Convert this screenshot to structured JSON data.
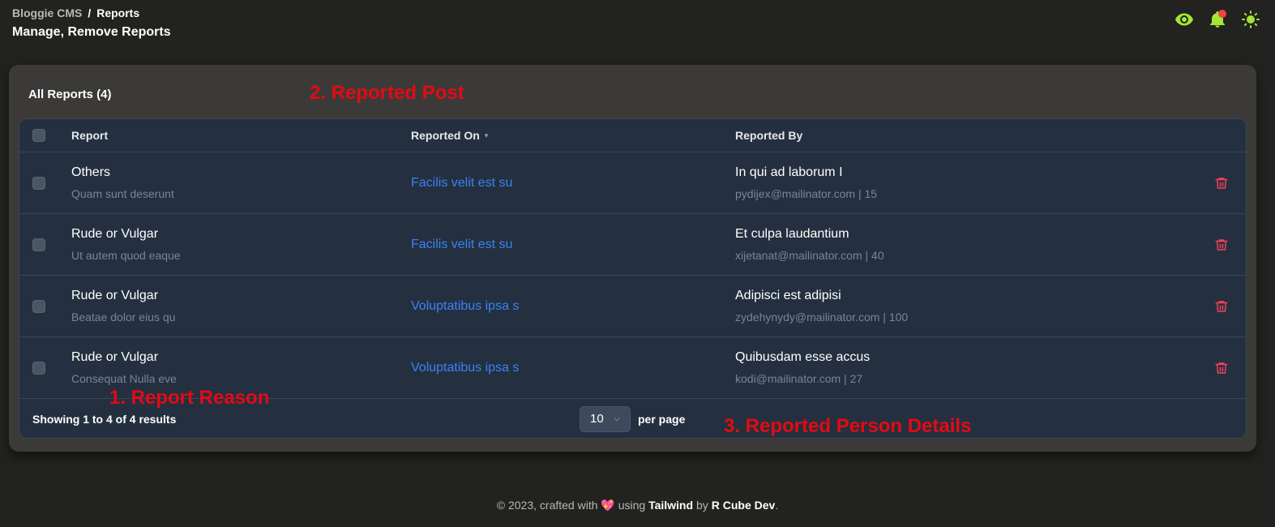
{
  "breadcrumb": {
    "root": "Bloggie CMS",
    "separator": "/",
    "current": "Reports"
  },
  "page_title": "Manage, Remove Reports",
  "header_icons": [
    "eye-icon",
    "bell-icon",
    "sun-icon"
  ],
  "colors": {
    "accent_icons": "#a3e635",
    "link": "#3b82f6",
    "delete": "#f43f5e",
    "annotation": "#e50914"
  },
  "card": {
    "title": "All Reports (4)"
  },
  "table": {
    "headers": {
      "report": "Report",
      "reported_on": "Reported On",
      "reported_by": "Reported By"
    },
    "rows": [
      {
        "reason": "Others",
        "detail": "Quam sunt deserunt",
        "post": "Facilis velit est su",
        "name": "In qui ad laborum I",
        "email": "pydijex@mailinator.com",
        "count": "15"
      },
      {
        "reason": "Rude or Vulgar",
        "detail": "Ut autem quod eaque",
        "post": "Facilis velit est su",
        "name": "Et culpa laudantium",
        "email": "xijetanat@mailinator.com",
        "count": "40"
      },
      {
        "reason": "Rude or Vulgar",
        "detail": "Beatae dolor eius qu",
        "post": "Voluptatibus ipsa s",
        "name": "Adipisci est adipisi",
        "email": "zydehynydy@mailinator.com",
        "count": "100"
      },
      {
        "reason": "Rude or Vulgar",
        "detail": "Consequat Nulla eve",
        "post": "Voluptatibus ipsa s",
        "name": "Quibusdam esse accus",
        "email": "kodi@mailinator.com",
        "count": "27"
      }
    ],
    "pipe": "|"
  },
  "pagination": {
    "showing": "Showing 1 to 4 of 4 results",
    "per_page_value": "10",
    "per_page_label": "per page"
  },
  "annotations": {
    "a1": "1. Report Reason",
    "a2": "2. Reported Post",
    "a3": "3. Reported Person Details"
  },
  "footer": {
    "prefix": "© 2023, crafted with",
    "heart": "💖",
    "using": "using",
    "tech": "Tailwind",
    "by": "by",
    "author": "R Cube Dev",
    "suffix": "."
  }
}
